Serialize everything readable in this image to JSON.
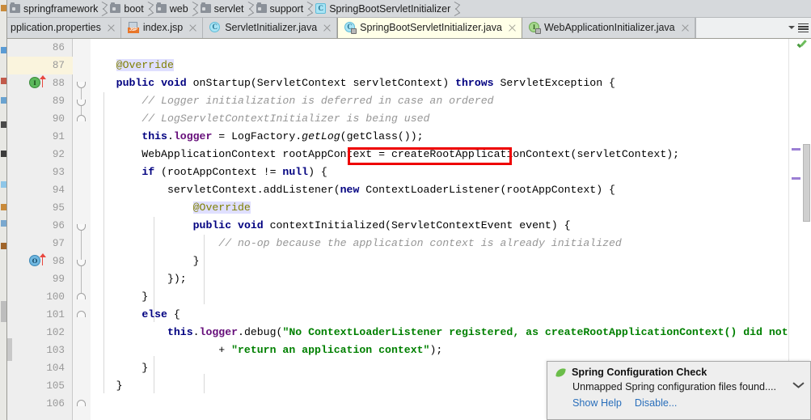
{
  "breadcrumb": {
    "items": [
      {
        "label": "springframework",
        "icon": "folder-icon"
      },
      {
        "label": "boot",
        "icon": "folder-icon"
      },
      {
        "label": "web",
        "icon": "folder-icon"
      },
      {
        "label": "servlet",
        "icon": "folder-icon"
      },
      {
        "label": "support",
        "icon": "folder-icon"
      },
      {
        "label": "SpringBootServletInitializer",
        "icon": "class-icon"
      }
    ]
  },
  "tabs": {
    "items": [
      {
        "label": "pplication.properties",
        "icon": "properties-file-icon",
        "active": false
      },
      {
        "label": "index.jsp",
        "icon": "jsp-file-icon",
        "active": false
      },
      {
        "label": "ServletInitializer.java",
        "icon": "java-class-icon",
        "active": false
      },
      {
        "label": "SpringBootServletInitializer.java",
        "icon": "java-class-locked-icon",
        "active": true
      },
      {
        "label": "WebApplicationInitializer.java",
        "icon": "java-interface-locked-icon",
        "active": false
      }
    ],
    "right_controls": [
      {
        "name": "tab-list-dropdown-arrow",
        "icon": "chevron-down-icon"
      },
      {
        "name": "tab-list-button",
        "icon": "list-icon"
      }
    ]
  },
  "editor": {
    "first_line": 86,
    "highlighted_line": 87,
    "annotation": {
      "color": "#ee0000",
      "target_text": "createRootApplicationContext",
      "line": 92
    },
    "gutter_icons": [
      {
        "line": 88,
        "type": "implementing-method-icon",
        "glyph": "I",
        "color": "#5cb85c"
      },
      {
        "line": 96,
        "type": "overriding-method-icon",
        "glyph": "O",
        "color": "#6fb7e0"
      }
    ],
    "lines": [
      {
        "n": 86,
        "text": ""
      },
      {
        "n": 87,
        "text": "    @Override"
      },
      {
        "n": 88,
        "text": "    public void onStartup(ServletContext servletContext) throws ServletException {"
      },
      {
        "n": 89,
        "text": "        // Logger initialization is deferred in case an ordered"
      },
      {
        "n": 90,
        "text": "        // LogServletContextInitializer is being used"
      },
      {
        "n": 91,
        "text": "        this.logger = LogFactory.getLog(getClass());"
      },
      {
        "n": 92,
        "text": "        WebApplicationContext rootAppContext = createRootApplicationContext(servletContext);"
      },
      {
        "n": 93,
        "text": "        if (rootAppContext != null) {"
      },
      {
        "n": 94,
        "text": "            servletContext.addListener(new ContextLoaderListener(rootAppContext) {"
      },
      {
        "n": 95,
        "text": "                @Override"
      },
      {
        "n": 96,
        "text": "                public void contextInitialized(ServletContextEvent event) {"
      },
      {
        "n": 97,
        "text": "                    // no-op because the application context is already initialized"
      },
      {
        "n": 98,
        "text": "                }"
      },
      {
        "n": 99,
        "text": "            });"
      },
      {
        "n": 100,
        "text": "        }"
      },
      {
        "n": 101,
        "text": "        else {"
      },
      {
        "n": 102,
        "text": "            this.logger.debug(\"No ContextLoaderListener registered, as createRootApplicationContext() did not \""
      },
      {
        "n": 103,
        "text": "                    + \"return an application context\");"
      },
      {
        "n": 104,
        "text": "        }"
      },
      {
        "n": 105,
        "text": "    }"
      },
      {
        "n": 106,
        "text": ""
      }
    ]
  },
  "notification": {
    "icon": "spring-leaf-icon",
    "title": "Spring Configuration Check",
    "message": "Unmapped Spring configuration files found....",
    "expand_icon": "chevron-down-icon",
    "actions": [
      {
        "label": "Show Help"
      },
      {
        "label": "Disable..."
      }
    ]
  },
  "status_markers": {
    "inspection_ok_icon": "green-check-icon",
    "scrollbar_marks_color": "#9b7fd4"
  }
}
